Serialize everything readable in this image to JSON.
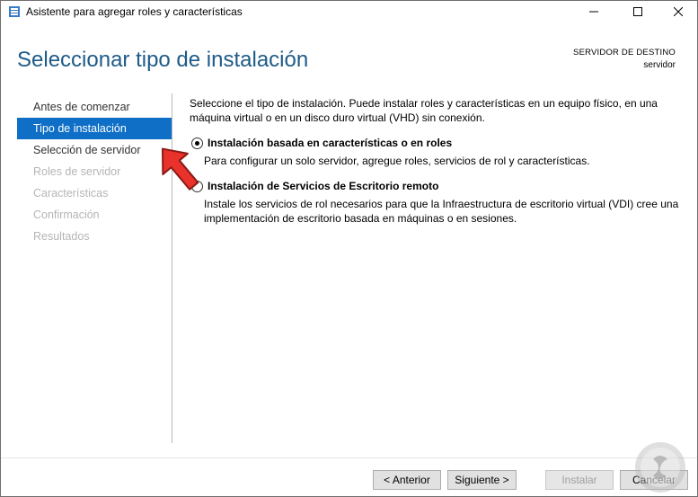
{
  "window": {
    "title": "Asistente para agregar roles y características",
    "min_icon": "minimize-icon",
    "max_icon": "maximize-icon",
    "close_icon": "close-icon"
  },
  "header": {
    "title": "Seleccionar tipo de instalación",
    "destination_label": "SERVIDOR DE DESTINO",
    "destination_value": "servidor"
  },
  "sidebar": {
    "items": [
      {
        "label": "Antes de comenzar",
        "state": "normal"
      },
      {
        "label": "Tipo de instalación",
        "state": "active"
      },
      {
        "label": "Selección de servidor",
        "state": "normal"
      },
      {
        "label": "Roles de servidor",
        "state": "disabled"
      },
      {
        "label": "Características",
        "state": "disabled"
      },
      {
        "label": "Confirmación",
        "state": "disabled"
      },
      {
        "label": "Resultados",
        "state": "disabled"
      }
    ]
  },
  "main": {
    "description_line1": "Seleccione el tipo de instalación. Puede instalar roles y características en un equipo físico, en una",
    "description_line2": "máquina virtual o en un disco duro virtual (VHD) sin conexión.",
    "options": [
      {
        "label": "Instalación basada en características o en roles",
        "description": "Para configurar un solo servidor, agregue roles, servicios de rol y características.",
        "selected": true
      },
      {
        "label": "Instalación de Servicios de Escritorio remoto",
        "description_line1": "Instale los servicios de rol necesarios para que la Infraestructura de escritorio virtual (VDI) cree una",
        "description_line2": "implementación de escritorio basada en máquinas o en sesiones.",
        "selected": false
      }
    ]
  },
  "footer": {
    "prev_label": "< Anterior",
    "next_label": "Siguiente >",
    "install_label": "Instalar",
    "cancel_label": "Cancelar"
  },
  "colors": {
    "title_blue": "#1e5b88",
    "active_nav": "#0f6fc6",
    "arrow_red": "#e8322b"
  }
}
